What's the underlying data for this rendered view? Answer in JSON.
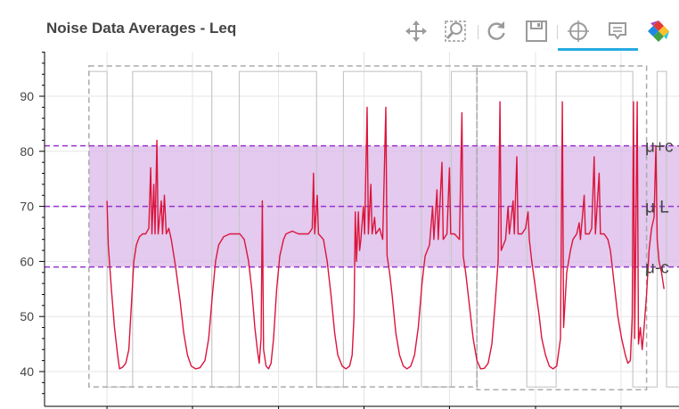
{
  "chart": {
    "title": "Noise Data Averages - Leq"
  },
  "toolbar": {
    "tools": [
      {
        "name": "pan-tool",
        "icon": "move-arrows-icon"
      },
      {
        "name": "box-zoom-tool",
        "icon": "box-zoom-icon"
      },
      {
        "name": "reset-tool",
        "icon": "reset-icon"
      },
      {
        "name": "save-tool",
        "icon": "save-icon"
      },
      {
        "name": "crosshair-tool",
        "icon": "crosshair-icon"
      },
      {
        "name": "hover-tool",
        "icon": "hover-tooltip-icon"
      },
      {
        "name": "bokeh-logo",
        "icon": "bokeh-logo-icon"
      }
    ],
    "active_color": "#26aae1"
  },
  "chart_data": {
    "type": "line",
    "title": "Noise Data Averages - Leq",
    "xlabel": "",
    "ylabel": "",
    "ylim": [
      35.5,
      98
    ],
    "xlim": [
      0,
      100
    ],
    "y_ticks": [
      40,
      50,
      60,
      70,
      80,
      90
    ],
    "grid": true,
    "colors": {
      "leq_line": "#dc143c",
      "band_fill": "#d9b8e8",
      "mean_lines": "#9932cc",
      "period_step": "#c8c8c8",
      "selection_box": "#aaaaaa"
    },
    "reference_lines": [
      {
        "label": "μ+σ",
        "display": "μ+c",
        "value": 81
      },
      {
        "label": "μ Leq",
        "display": "μ L",
        "value": 70
      },
      {
        "label": "μ-σ",
        "display": "μ-c",
        "value": 59
      }
    ],
    "band": {
      "from": 59,
      "to": 81
    },
    "period_step": {
      "high": 94.5,
      "low": 37.2,
      "edges": [
        8.3,
        12.4,
        25.1,
        29.5,
        41.9,
        46.2,
        58.7,
        63.5,
        75.6,
        80.3,
        92.6,
        96.5,
        98.0
      ]
    },
    "selection_boxes": [
      {
        "x0": 5.4,
        "x1": 67.6,
        "y0": 37.2,
        "y1": 95.5
      },
      {
        "x0": 67.6,
        "x1": 94.8,
        "y0": 36.7,
        "y1": 95.5
      }
    ],
    "series": [
      {
        "name": "Leq",
        "points": [
          [
            8.3,
            71
          ],
          [
            8.5,
            63
          ],
          [
            9.0,
            55
          ],
          [
            9.5,
            48
          ],
          [
            10.0,
            43
          ],
          [
            10.3,
            40.5
          ],
          [
            10.8,
            40.8
          ],
          [
            11.3,
            41.5
          ],
          [
            11.8,
            44
          ],
          [
            12.2,
            52
          ],
          [
            12.6,
            60
          ],
          [
            13.0,
            63
          ],
          [
            13.5,
            64.5
          ],
          [
            14.0,
            65
          ],
          [
            14.5,
            65
          ],
          [
            15.0,
            66
          ],
          [
            15.3,
            77
          ],
          [
            15.5,
            65
          ],
          [
            15.8,
            74
          ],
          [
            16.0,
            65
          ],
          [
            16.3,
            82
          ],
          [
            16.5,
            65
          ],
          [
            17.0,
            71
          ],
          [
            17.2,
            65
          ],
          [
            17.5,
            72
          ],
          [
            17.8,
            65
          ],
          [
            18.2,
            66
          ],
          [
            18.6,
            64
          ],
          [
            19.3,
            59
          ],
          [
            20.0,
            53
          ],
          [
            20.6,
            47
          ],
          [
            21.2,
            43
          ],
          [
            21.8,
            41
          ],
          [
            22.5,
            40.5
          ],
          [
            23.2,
            40.7
          ],
          [
            24.0,
            42
          ],
          [
            24.6,
            46
          ],
          [
            25.2,
            54
          ],
          [
            25.7,
            60
          ],
          [
            26.2,
            63
          ],
          [
            27.0,
            64.5
          ],
          [
            28.0,
            65
          ],
          [
            29.0,
            65
          ],
          [
            29.6,
            65
          ],
          [
            30.3,
            64
          ],
          [
            31.0,
            60
          ],
          [
            31.5,
            55
          ],
          [
            32.0,
            48
          ],
          [
            32.4,
            44
          ],
          [
            32.7,
            41.5
          ],
          [
            33.0,
            46
          ],
          [
            33.2,
            71
          ],
          [
            33.4,
            44
          ],
          [
            33.8,
            41
          ],
          [
            34.2,
            40.5
          ],
          [
            34.6,
            41.5
          ],
          [
            35.0,
            46
          ],
          [
            35.5,
            55
          ],
          [
            36.0,
            61
          ],
          [
            36.6,
            64
          ],
          [
            37.0,
            65
          ],
          [
            38.0,
            65.5
          ],
          [
            39.0,
            65
          ],
          [
            40.0,
            65
          ],
          [
            40.6,
            65
          ],
          [
            41.2,
            66
          ],
          [
            41.4,
            76
          ],
          [
            41.6,
            65
          ],
          [
            42.0,
            72
          ],
          [
            42.2,
            65
          ],
          [
            43.0,
            64
          ],
          [
            43.6,
            60
          ],
          [
            44.2,
            54
          ],
          [
            44.8,
            47
          ],
          [
            45.3,
            43
          ],
          [
            46.0,
            41
          ],
          [
            46.6,
            40.5
          ],
          [
            47.2,
            41
          ],
          [
            47.6,
            43
          ],
          [
            47.9,
            50
          ],
          [
            48.1,
            69
          ],
          [
            48.3,
            60
          ],
          [
            48.6,
            69
          ],
          [
            48.8,
            62
          ],
          [
            49.0,
            64
          ],
          [
            49.4,
            70
          ],
          [
            49.6,
            65
          ],
          [
            50.0,
            88
          ],
          [
            50.2,
            65
          ],
          [
            50.6,
            74
          ],
          [
            50.8,
            65
          ],
          [
            51.2,
            68
          ],
          [
            51.4,
            65
          ],
          [
            52.0,
            66
          ],
          [
            52.5,
            64
          ],
          [
            53.0,
            88
          ],
          [
            53.2,
            61
          ],
          [
            53.6,
            58
          ],
          [
            54.0,
            54
          ],
          [
            54.6,
            47
          ],
          [
            55.2,
            43
          ],
          [
            55.8,
            41
          ],
          [
            56.4,
            40.5
          ],
          [
            57.0,
            41
          ],
          [
            57.6,
            43
          ],
          [
            58.2,
            48
          ],
          [
            58.8,
            56
          ],
          [
            59.3,
            61
          ],
          [
            60.0,
            63
          ],
          [
            60.5,
            70
          ],
          [
            60.7,
            64
          ],
          [
            61.2,
            73
          ],
          [
            61.4,
            64
          ],
          [
            62.0,
            78
          ],
          [
            62.2,
            64
          ],
          [
            62.8,
            65
          ],
          [
            63.2,
            77
          ],
          [
            63.4,
            65
          ],
          [
            64.0,
            65
          ],
          [
            64.8,
            64
          ],
          [
            65.2,
            87
          ],
          [
            65.4,
            61
          ],
          [
            65.8,
            58
          ],
          [
            66.3,
            53
          ],
          [
            67.0,
            46
          ],
          [
            67.6,
            42
          ],
          [
            68.2,
            40.5
          ],
          [
            68.8,
            40.6
          ],
          [
            69.4,
            41.5
          ],
          [
            70.0,
            45
          ],
          [
            70.5,
            52
          ],
          [
            71.0,
            60
          ],
          [
            71.3,
            89
          ],
          [
            71.5,
            62
          ],
          [
            72.2,
            64
          ],
          [
            72.6,
            70
          ],
          [
            72.8,
            65
          ],
          [
            73.4,
            71
          ],
          [
            73.6,
            65
          ],
          [
            74.0,
            79
          ],
          [
            74.2,
            65
          ],
          [
            74.8,
            65
          ],
          [
            75.4,
            66
          ],
          [
            75.8,
            69
          ],
          [
            76.0,
            64
          ],
          [
            76.4,
            60
          ],
          [
            77.0,
            55
          ],
          [
            77.6,
            50
          ],
          [
            78.0,
            46
          ],
          [
            78.6,
            43
          ],
          [
            79.2,
            41
          ],
          [
            79.8,
            40.5
          ],
          [
            80.4,
            41
          ],
          [
            81.0,
            46
          ],
          [
            81.3,
            89
          ],
          [
            81.5,
            48
          ],
          [
            82.0,
            58
          ],
          [
            82.6,
            62
          ],
          [
            83.0,
            64
          ],
          [
            83.6,
            65
          ],
          [
            84.0,
            67
          ],
          [
            84.2,
            64
          ],
          [
            84.8,
            72
          ],
          [
            85.0,
            65
          ],
          [
            85.6,
            65
          ],
          [
            86.0,
            66
          ],
          [
            86.4,
            79
          ],
          [
            86.6,
            65
          ],
          [
            87.2,
            76
          ],
          [
            87.4,
            65
          ],
          [
            88.0,
            65
          ],
          [
            88.6,
            64
          ],
          [
            89.0,
            62
          ],
          [
            89.6,
            56
          ],
          [
            90.2,
            50
          ],
          [
            90.8,
            46
          ],
          [
            91.4,
            43
          ],
          [
            91.8,
            41.5
          ],
          [
            92.2,
            42
          ],
          [
            92.5,
            50
          ],
          [
            92.7,
            89
          ],
          [
            92.9,
            46
          ],
          [
            93.3,
            89
          ],
          [
            93.5,
            45
          ],
          [
            93.8,
            48
          ],
          [
            94.1,
            44
          ],
          [
            94.4,
            48
          ],
          [
            94.8,
            54
          ],
          [
            95.2,
            62
          ],
          [
            95.6,
            66
          ],
          [
            96.0,
            68
          ],
          [
            96.3,
            81
          ],
          [
            96.5,
            64
          ],
          [
            96.8,
            60
          ],
          [
            97.2,
            58
          ],
          [
            97.6,
            55
          ]
        ]
      }
    ]
  }
}
